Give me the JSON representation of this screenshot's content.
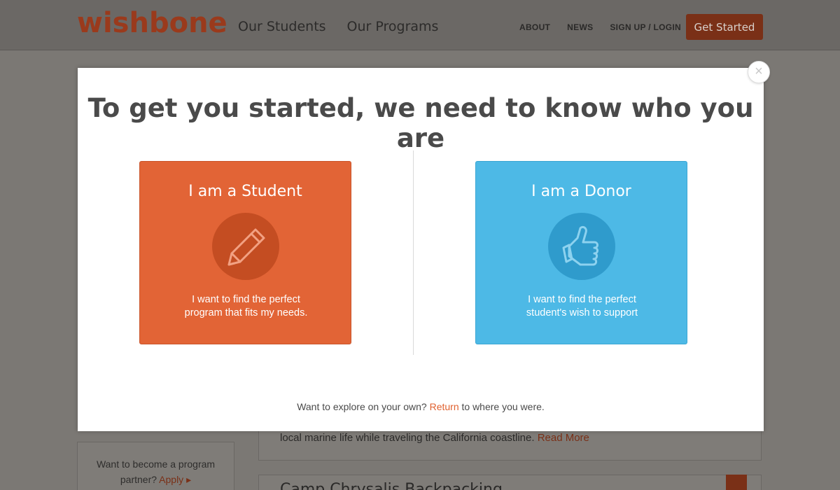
{
  "header": {
    "logo": "wishbone",
    "main_nav": [
      "Our Students",
      "Our Programs"
    ],
    "util_nav": [
      "ABOUT",
      "NEWS",
      "SIGN UP / LOGIN"
    ],
    "cta": "Get Started"
  },
  "background": {
    "card_text": "local marine life while traveling the California coastline.",
    "card_link": "Read More",
    "next_card_title": "Camp Chrysalis Backpacking",
    "partner_text": "Want to become a program partner?",
    "partner_link": "Apply",
    "partner_arrow": "▸"
  },
  "modal": {
    "close_glyph": "×",
    "title": "To get you started, we need to know who you are",
    "student": {
      "title": "I am a Student",
      "line1": "I want to find the perfect",
      "line2": "program that fits my needs.",
      "icon": "pencil-icon"
    },
    "donor": {
      "title": "I am a Donor",
      "line1": "I want to find the perfect",
      "line2": "student's wish to support",
      "icon": "thumbs-up-icon"
    },
    "footer_prefix": "Want to explore on your own?",
    "footer_link": "Return",
    "footer_suffix": "to where you were."
  },
  "colors": {
    "brand": "#e26436",
    "donor": "#4db9e6",
    "link": "#e0612f"
  }
}
